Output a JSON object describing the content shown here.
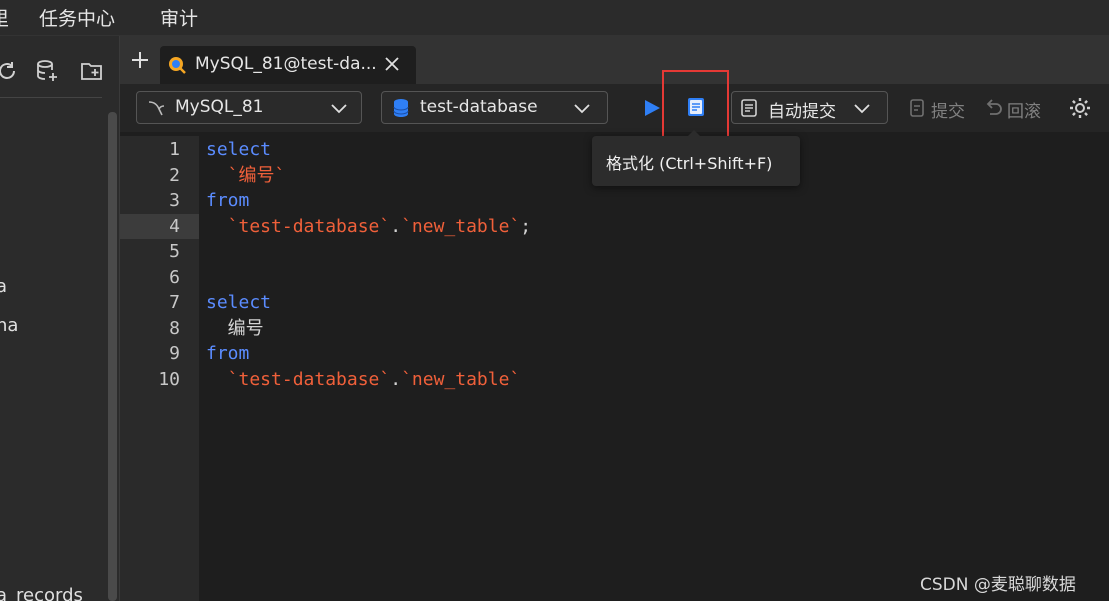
{
  "menu": {
    "items": [
      "里",
      "任务中心",
      "审计"
    ]
  },
  "sidebar": {
    "texts": [
      "a",
      "na",
      "a_records"
    ]
  },
  "tab": {
    "title": "MySQL_81@test-da..."
  },
  "toolbar": {
    "connection": "MySQL_81",
    "database": "test-database",
    "autocommit": "自动提交",
    "commit": "提交",
    "rollback": "回滚"
  },
  "tooltip": {
    "text": "格式化 (Ctrl+Shift+F)"
  },
  "editor": {
    "active_line": 4,
    "lines": [
      {
        "num": "1",
        "segments": [
          {
            "text": "select",
            "cls": "kw"
          }
        ]
      },
      {
        "num": "2",
        "segments": [
          {
            "text": "  `编号`",
            "cls": "str"
          }
        ]
      },
      {
        "num": "3",
        "segments": [
          {
            "text": "from",
            "cls": "kw"
          }
        ]
      },
      {
        "num": "4",
        "segments": [
          {
            "text": "  `test-database`",
            "cls": "str"
          },
          {
            "text": ".",
            "cls": "pl"
          },
          {
            "text": "`new_table`",
            "cls": "str"
          },
          {
            "text": ";",
            "cls": "pl"
          }
        ]
      },
      {
        "num": "5",
        "segments": []
      },
      {
        "num": "6",
        "segments": []
      },
      {
        "num": "7",
        "segments": [
          {
            "text": "select",
            "cls": "kw"
          }
        ]
      },
      {
        "num": "8",
        "segments": [
          {
            "text": "  编号",
            "cls": "pl"
          }
        ]
      },
      {
        "num": "9",
        "segments": [
          {
            "text": "from",
            "cls": "kw"
          }
        ]
      },
      {
        "num": "10",
        "segments": [
          {
            "text": "  `test-database`",
            "cls": "str"
          },
          {
            "text": ".",
            "cls": "pl"
          },
          {
            "text": "`new_table`",
            "cls": "str"
          }
        ]
      }
    ]
  },
  "watermark": "CSDN @麦聪聊数据",
  "colors": {
    "keyword": "#5b8cff",
    "string": "#f0603a",
    "run": "#2f7ff5",
    "highlight": "#e53935"
  }
}
